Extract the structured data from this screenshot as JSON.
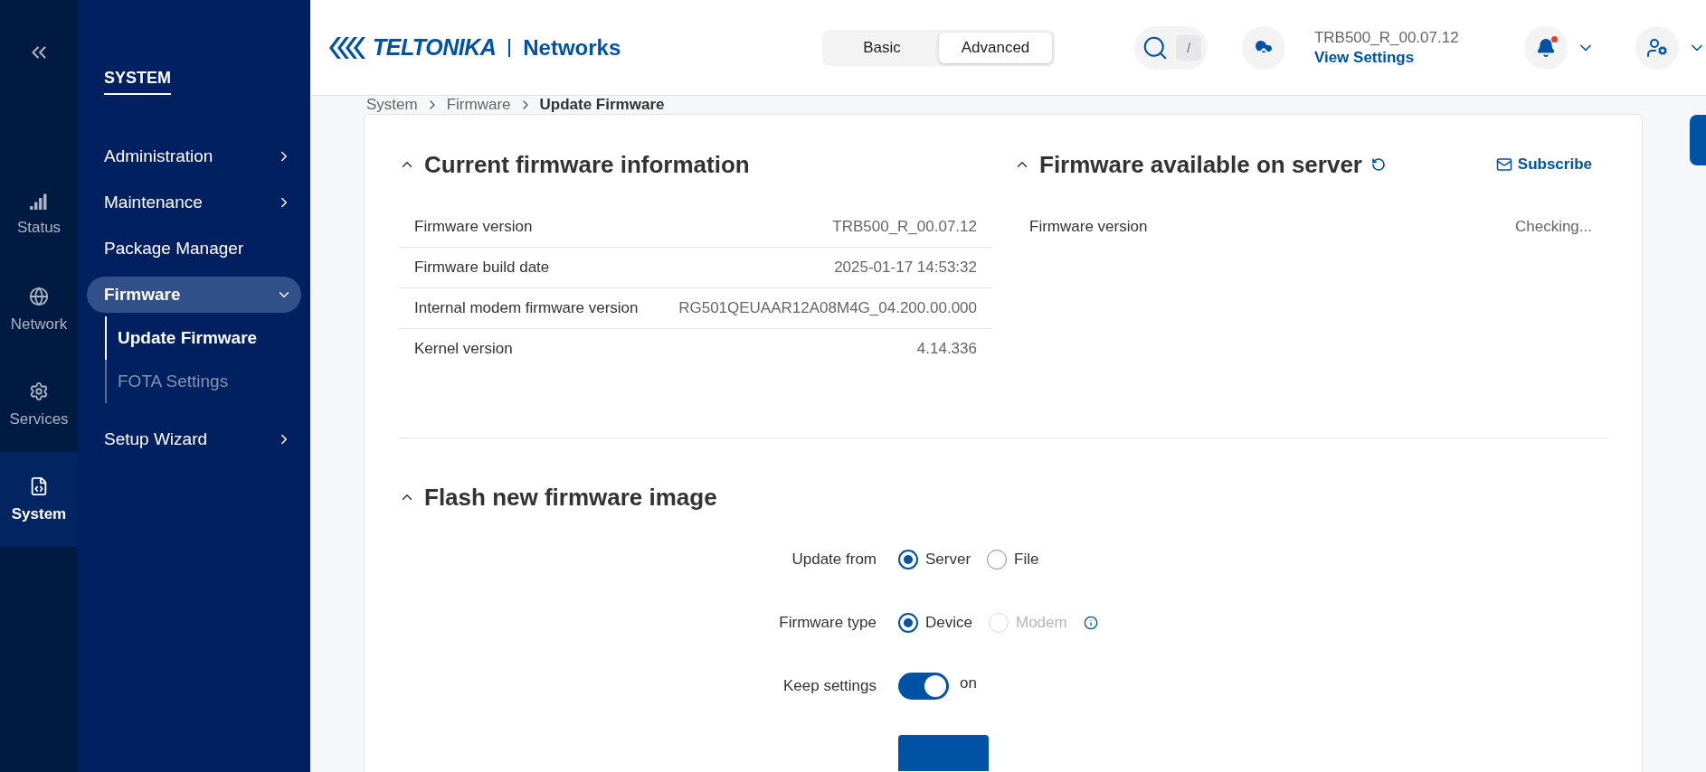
{
  "rail": [
    {
      "label": "Status",
      "kind": "status",
      "selected": false
    },
    {
      "label": "Network",
      "kind": "network",
      "selected": false
    },
    {
      "label": "Services",
      "kind": "services",
      "selected": false
    },
    {
      "label": "System",
      "kind": "system",
      "selected": true
    }
  ],
  "sidebar": {
    "title": "SYSTEM",
    "items": [
      {
        "label": "Administration",
        "kind": "group",
        "expanded": false,
        "selected": false
      },
      {
        "label": "Maintenance",
        "kind": "group",
        "expanded": false,
        "selected": false
      },
      {
        "label": "Package Manager",
        "kind": "link",
        "selected": false
      },
      {
        "label": "Firmware",
        "kind": "group",
        "expanded": true,
        "selected": true,
        "children": [
          {
            "label": "Update Firmware",
            "selected": true
          },
          {
            "label": "FOTA Settings",
            "selected": false
          }
        ]
      },
      {
        "label": "Setup Wizard",
        "kind": "group",
        "expanded": false,
        "selected": false
      }
    ]
  },
  "header": {
    "brand": "TELTONIKA",
    "product": "Networks",
    "mode_tabs": [
      {
        "label": "Basic",
        "selected": false
      },
      {
        "label": "Advanced",
        "selected": true
      }
    ],
    "search_shortcut": "/",
    "device": "TRB500_R_00.07.12",
    "device_link": "View Settings",
    "notifications_unread": true
  },
  "breadcrumb": [
    "System",
    "Firmware",
    "Update Firmware"
  ],
  "current_info": {
    "title": "Current firmware information",
    "expanded": true,
    "rows": [
      {
        "label": "Firmware version",
        "value": "TRB500_R_00.07.12"
      },
      {
        "label": "Firmware build date",
        "value": "2025-01-17 14:53:32"
      },
      {
        "label": "Internal modem firmware version",
        "value": "RG501QEUAAR12A08M4G_04.200.00.000"
      },
      {
        "label": "Kernel version",
        "value": "4.14.336"
      }
    ]
  },
  "server_info": {
    "title": "Firmware available on server",
    "expanded": true,
    "subscribe": "Subscribe",
    "rows": [
      {
        "label": "Firmware version",
        "value": "Checking..."
      }
    ]
  },
  "flash": {
    "title": "Flash new firmware image",
    "expanded": true,
    "fields": [
      {
        "kind": "radio",
        "label": "Update from",
        "info": false,
        "options": [
          {
            "label": "Server",
            "selected": true,
            "disabled": false
          },
          {
            "label": "File",
            "selected": false,
            "disabled": false
          }
        ]
      },
      {
        "kind": "radio",
        "label": "Firmware type",
        "info": true,
        "options": [
          {
            "label": "Device",
            "selected": true,
            "disabled": false
          },
          {
            "label": "Modem",
            "selected": false,
            "disabled": true
          }
        ]
      },
      {
        "kind": "toggle",
        "label": "Keep settings",
        "on": true,
        "state_text": "on"
      },
      {
        "kind": "button"
      }
    ]
  }
}
